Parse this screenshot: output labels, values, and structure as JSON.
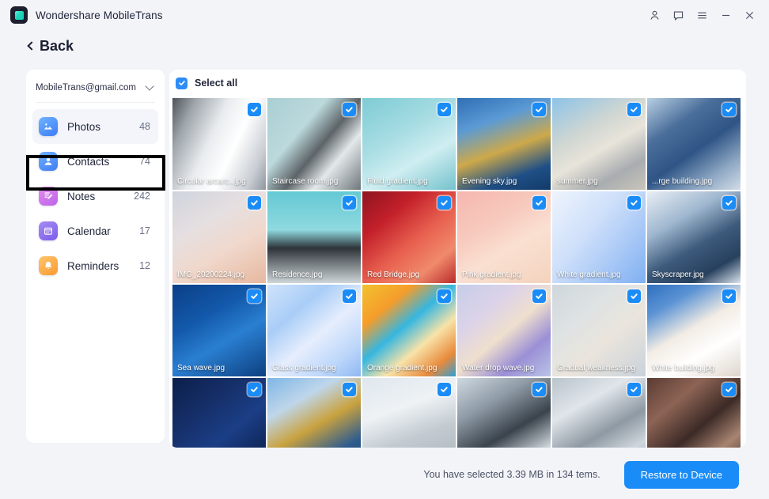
{
  "window": {
    "app_title": "Wondershare MobileTrans",
    "logo_icon": "mobiletrans-logo-icon",
    "controls": [
      {
        "name": "account-icon",
        "glyph": "person"
      },
      {
        "name": "feedback-icon",
        "glyph": "chat"
      },
      {
        "name": "menu-icon",
        "glyph": "hamburger"
      },
      {
        "name": "minimize-icon",
        "glyph": "minimize"
      },
      {
        "name": "close-icon",
        "glyph": "close"
      }
    ]
  },
  "nav": {
    "back_label": "Back"
  },
  "sidebar": {
    "account_email": "MobileTrans@gmail.com",
    "account_caret_icon": "chevron-down-icon",
    "items": [
      {
        "label": "Photos",
        "count": "48",
        "icon": "photos-icon",
        "active": true
      },
      {
        "label": "Contacts",
        "count": "74",
        "icon": "contacts-icon",
        "active": false
      },
      {
        "label": "Notes",
        "count": "242",
        "icon": "notes-icon",
        "active": false
      },
      {
        "label": "Calendar",
        "count": "17",
        "icon": "calendar-icon",
        "active": false
      },
      {
        "label": "Reminders",
        "count": "12",
        "icon": "reminders-icon",
        "active": false
      }
    ],
    "highlighted_item": "Contacts"
  },
  "content": {
    "select_all_label": "Select all",
    "select_all_checked": true,
    "items": [
      {
        "name": "Circular arcarc...jpg",
        "checked": true,
        "label_visible": true,
        "bg": "linear-gradient(115deg,#4e5358 0%,#9fa6ac 18%,#e9ecef 42%,#ffffff 62%,#c9ced4 85%,#8e969d 100%)"
      },
      {
        "name": "Staircase room.jpg",
        "checked": true,
        "label_visible": true,
        "bg": "linear-gradient(130deg,#a9cfd3 0%,#bcd9dc 35%,#5d6468 55%,#e3e8ea 72%,#6d767b 100%)"
      },
      {
        "name": "Fluid gradient.jpg",
        "checked": true,
        "label_visible": true,
        "bg": "linear-gradient(150deg,#7ecbd4 0%,#a8dde3 40%,#cfeef1 65%,#74c2cd 100%)"
      },
      {
        "name": "Evening sky.jpg",
        "checked": true,
        "label_visible": true,
        "bg": "linear-gradient(160deg,#2f6fb5 0%,#5b9ad4 28%,#cda94a 55%,#1f4f86 80%,#123a68 100%)"
      },
      {
        "name": "summer.jpg",
        "checked": true,
        "label_visible": true,
        "bg": "linear-gradient(150deg,#8cc3e8 0%,#cfd6d2 35%,#e8e4da 55%,#a9adb0 78%,#c8c4bb 100%)"
      },
      {
        "name": "...rge building.jpg",
        "checked": true,
        "label_visible": true,
        "bg": "linear-gradient(145deg,#b9cfe3 0%,#4b6f9b 30%,#2f5586 55%,#90a9c4 80%,#d2dde8 100%)"
      },
      {
        "name": "IMG_20200224.jpg",
        "checked": true,
        "label_visible": true,
        "bg": "linear-gradient(150deg,#cfd4dd 0%,#e6dfe0 35%,#f0d8cc 62%,#e7b89f 100%)"
      },
      {
        "name": "Residence.jpg",
        "checked": true,
        "label_visible": true,
        "bg": "linear-gradient(180deg,#64c9d4 0%,#8fd9df 42%,#2d3338 62%,#cfd6d9 100%)"
      },
      {
        "name": "Red Bridge.jpg",
        "checked": true,
        "label_visible": true,
        "bg": "linear-gradient(140deg,#8e1420 0%,#c3202a 28%,#e8604f 55%,#f08a6b 78%,#b82b2b 100%)"
      },
      {
        "name": "Pink gradient.jpg",
        "checked": true,
        "label_visible": true,
        "bg": "linear-gradient(150deg,#f6b7b0 0%,#f7c9bd 35%,#fae0d2 60%,#f3d3bd 100%)"
      },
      {
        "name": "White gradient.jpg",
        "checked": true,
        "label_visible": true,
        "bg": "linear-gradient(130deg,#eef4fd 0%,#cfe0fa 40%,#a8c8f6 70%,#7fb0f2 100%)"
      },
      {
        "name": "Skyscraper.jpg",
        "checked": true,
        "label_visible": true,
        "bg": "linear-gradient(150deg,#e8eef5 0%,#9fb7cf 32%,#3d5a7c 58%,#27405d 80%,#dbe4ee 100%)"
      },
      {
        "name": "Sea wave.jpg",
        "checked": true,
        "label_visible": true,
        "bg": "linear-gradient(150deg,#0b3f86 0%,#1359ab 35%,#2a7fd1 60%,#0d3f80 100%)"
      },
      {
        "name": "Glass gradient.jpg",
        "checked": true,
        "label_visible": true,
        "bg": "linear-gradient(140deg,#cfe3fb 0%,#a9cdf7 30%,#e6eefd 55%,#bcd6fa 80%,#8fb8f2 100%)"
      },
      {
        "name": "Orange gradient.jpg",
        "checked": true,
        "label_visible": true,
        "bg": "linear-gradient(140deg,#f2c12e 0%,#f59d2b 25%,#36b6e0 45%,#f8e3a8 65%,#e88a3c 85%,#2f9fd4 100%)"
      },
      {
        "name": "Water drop wave.jpg",
        "checked": true,
        "label_visible": true,
        "bg": "linear-gradient(140deg,#c6cde8 0%,#dcd3e8 30%,#efdfcd 52%,#9b8fd6 75%,#b9c4e6 100%)"
      },
      {
        "name": "Gradual weakness.jpg",
        "checked": true,
        "label_visible": true,
        "bg": "linear-gradient(140deg,#cfd7dd 0%,#dfe3e3 35%,#eae4dc 60%,#c9d2da 100%)"
      },
      {
        "name": "White building.jpg",
        "checked": true,
        "label_visible": true,
        "bg": "linear-gradient(150deg,#2f6fbf 0%,#5b93d4 22%,#f2ece4 48%,#ffffff 70%,#ded6cc 100%)"
      },
      {
        "name": "",
        "checked": true,
        "label_visible": false,
        "bg": "linear-gradient(140deg,#0b1f4a 0%,#16306b 35%,#1b3e86 60%,#0a1c42 100%)"
      },
      {
        "name": "",
        "checked": true,
        "label_visible": false,
        "bg": "linear-gradient(150deg,#7fb6e6 0%,#bfd6ea 28%,#c9a23f 52%,#2f5c8e 78%,#1d3f68 100%)"
      },
      {
        "name": "",
        "checked": true,
        "label_visible": false,
        "bg": "linear-gradient(160deg,#dfe7ee 0%,#eef2f5 35%,#c3cbd1 62%,#aab3ba 100%)"
      },
      {
        "name": "",
        "checked": true,
        "label_visible": false,
        "bg": "linear-gradient(150deg,#cfd9e2 0%,#8e9aa5 30%,#3a434c 58%,#d7dee4 85%,#6f7a85 100%)"
      },
      {
        "name": "",
        "checked": true,
        "label_visible": false,
        "bg": "linear-gradient(150deg,#b9c4cc 0%,#e0e5ea 30%,#8e99a3 58%,#cfd6dc 80%,#9aa4ad 100%)"
      },
      {
        "name": "",
        "checked": true,
        "label_visible": false,
        "bg": "linear-gradient(140deg,#5a3b33 0%,#8d6455 28%,#3c2a26 55%,#a88471 78%,#4a342d 100%)"
      }
    ]
  },
  "footer": {
    "selection_text": "You have selected 3.39 MB in 134 tems.",
    "restore_label": "Restore to Device",
    "accent_color": "#1a8cf8"
  }
}
